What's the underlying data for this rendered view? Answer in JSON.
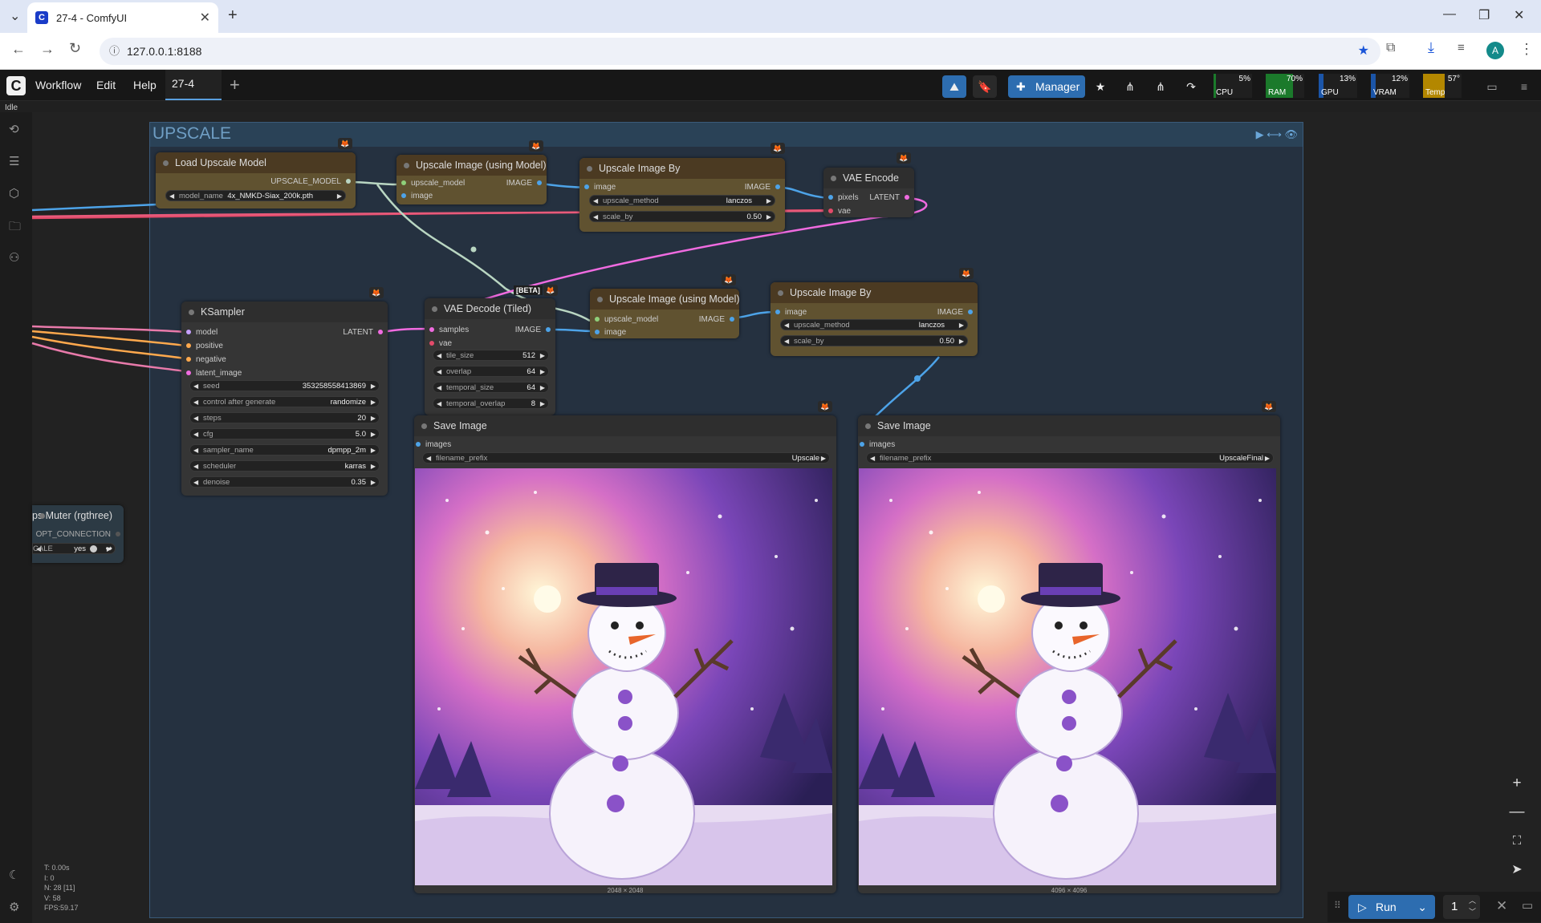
{
  "browser": {
    "tab_title": "27-4 - ComfyUI",
    "url": "127.0.0.1:8188",
    "avatar": "A"
  },
  "menubar": {
    "items": [
      "Workflow",
      "Edit",
      "Help"
    ],
    "active_tab": "27-4",
    "manager_label": "Manager"
  },
  "monitors": [
    {
      "label": "CPU",
      "value": "5%",
      "fill": 0.05,
      "color": "#1b7a2b"
    },
    {
      "label": "RAM",
      "value": "70%",
      "fill": 0.7,
      "color": "#1b7a2b"
    },
    {
      "label": "GPU",
      "value": "13%",
      "fill": 0.13,
      "color": "#1b55a8"
    },
    {
      "label": "VRAM",
      "value": "12%",
      "fill": 0.12,
      "color": "#1b55a8"
    },
    {
      "label": "Temp",
      "value": "57°",
      "fill": 0.57,
      "color": "#b38700"
    }
  ],
  "status": "Idle",
  "group": {
    "title": "UPSCALE"
  },
  "nodes": {
    "load_upscale": {
      "title": "Load Upscale Model",
      "out": "UPSCALE_MODEL",
      "model_name_key": "model_name",
      "model_name": "4x_NMKD-Siax_200k.pth"
    },
    "upscale_model_1": {
      "title": "Upscale Image (using Model)",
      "in1": "upscale_model",
      "in2": "image",
      "out": "IMAGE"
    },
    "upscale_by_1": {
      "title": "Upscale Image By",
      "in": "image",
      "out": "IMAGE",
      "method_key": "upscale_method",
      "method": "lanczos",
      "scale_key": "scale_by",
      "scale": "0.50"
    },
    "vae_encode": {
      "title": "VAE Encode",
      "in1": "pixels",
      "in2": "vae",
      "out": "LATENT"
    },
    "ksampler": {
      "title": "KSampler",
      "inputs": [
        "model",
        "positive",
        "negative",
        "latent_image"
      ],
      "out": "LATENT",
      "widgets": [
        {
          "k": "seed",
          "v": "353258558413869"
        },
        {
          "k": "control after generate",
          "v": "randomize"
        },
        {
          "k": "steps",
          "v": "20"
        },
        {
          "k": "cfg",
          "v": "5.0"
        },
        {
          "k": "sampler_name",
          "v": "dpmpp_2m"
        },
        {
          "k": "scheduler",
          "v": "karras"
        },
        {
          "k": "denoise",
          "v": "0.35"
        }
      ]
    },
    "vae_decode": {
      "title": "VAE Decode (Tiled)",
      "beta": "[BETA]",
      "in1": "samples",
      "in2": "vae",
      "out": "IMAGE",
      "widgets": [
        {
          "k": "tile_size",
          "v": "512"
        },
        {
          "k": "overlap",
          "v": "64"
        },
        {
          "k": "temporal_size",
          "v": "64"
        },
        {
          "k": "temporal_overlap",
          "v": "8"
        }
      ]
    },
    "upscale_model_2": {
      "title": "Upscale Image (using Model)",
      "in1": "upscale_model",
      "in2": "image",
      "out": "IMAGE"
    },
    "upscale_by_2": {
      "title": "Upscale Image By",
      "in": "image",
      "out": "IMAGE",
      "method_key": "upscale_method",
      "method": "lanczos",
      "scale_key": "scale_by",
      "scale": "0.50"
    },
    "save_1": {
      "title": "Save Image",
      "in": "images",
      "prefix_key": "filename_prefix",
      "prefix": "Upscale",
      "size": "2048 × 2048"
    },
    "save_2": {
      "title": "Save Image",
      "in": "images",
      "prefix_key": "filename_prefix",
      "prefix": "UpscaleFinal",
      "size": "4096 × 4096"
    },
    "muter": {
      "title": "ps Muter (rgthree)",
      "out": "OPT_CONNECTION",
      "toggle_label": "CALE",
      "toggle_value": "yes"
    }
  },
  "run": {
    "label": "Run",
    "count": "1"
  },
  "stats": [
    "T: 0.00s",
    "I: 0",
    "N: 28 [11]",
    "V: 58",
    "FPS:59.17"
  ]
}
